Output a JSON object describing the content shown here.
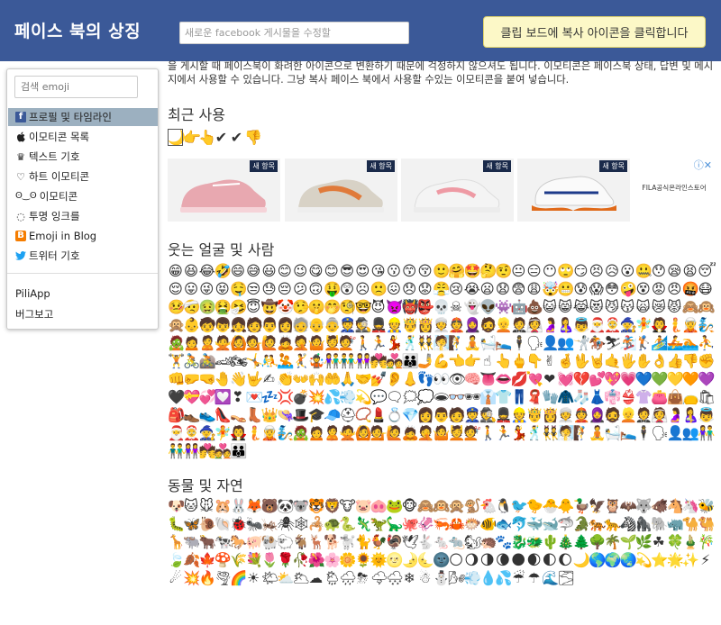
{
  "header": {
    "title": "페이스 북의 상징",
    "post_placeholder": "새로운 facebook 게시물을 수정할",
    "copy_hint": "클립 보드에 복사 아이콘을 클릭합니다"
  },
  "sidebar": {
    "search_placeholder": "검색 emoji",
    "items": [
      {
        "label": "프로필 및 타임라인",
        "icon": "facebook-icon",
        "glyph": "f"
      },
      {
        "label": "이모티콘 목록",
        "icon": "apple-icon",
        "glyph": ""
      },
      {
        "label": "텍스트 기호",
        "icon": "crown-icon",
        "glyph": "♛"
      },
      {
        "label": "하트 이모티콘",
        "icon": "heart-icon",
        "glyph": "♡"
      },
      {
        "label": "이모티콘",
        "icon": "face-text-icon",
        "glyph": "ʘ‿ʘ"
      },
      {
        "label": "투명 잉크를",
        "icon": "dotted-circle-icon",
        "glyph": "◌"
      },
      {
        "label": "Emoji in Blog",
        "icon": "blogger-icon",
        "glyph": "B"
      },
      {
        "label": "트위터 기호",
        "icon": "twitter-icon",
        "glyph": "🐦"
      },
      {
        "label": "PiliApp"
      },
      {
        "label": "버그보고"
      }
    ]
  },
  "intro": "을 게시할 때 페이스북이 화려한 아이콘으로 변환하기 때문에 걱정하지 않으셔도 됩니다. 이모티콘은 페이스북 상태, 답변 및 메시지에서 사용할 수 있습니다. 그냥 복사 페이스 북에서 사용할 수있는 이모티콘을 붙여 넣습니다.",
  "sections": {
    "recent": "최근 사용",
    "smileys": "웃는 얼굴 및 사람",
    "animals": "동물 및 자연"
  },
  "recent_emojis": [
    "🌙",
    "👉",
    "👆",
    "✔",
    "✔",
    "👎"
  ],
  "ad": {
    "badge": "새 항목",
    "brand": "FILA공식온라인스토어",
    "cards": [
      {
        "color": "#e8a8b0"
      },
      {
        "color": "#e07a3a"
      },
      {
        "color": "#ee9aa4"
      },
      {
        "color": "#e06a1a"
      }
    ]
  },
  "smileys_emojis": "😁😆😂🤣😄😅😃😊😉😋😊😎😍😘😗😙😚🙂🤗🤩🤔🤨😐😑😶🙄😏😣😥😮🤐😯😪😫😴😌😛😜😝🤤😒😓😔😕🙃🤑😲☹🙁😖😞😟😤😢😭😦😧😨😩🤯😬😰😱😳🤪😵😡😠🤬😷🤒🤕🤢🤮🤧😇🤠🤡🤥🤫🤭🧐🤓😈👿👹👺💀☠👻👽👾🤖💩😺😸😹😻😼😽🙀😿😾🙈🙉🙊👶🧒👦👧🧑👨👩🧓👴👵👮🕵💂👷🤴👸👳👲🧕🧔👱🤵👰🤰🤱👼🎅🤶🧙🧚🧛🧜🧝🧞🧟🙍🙎🙅🙆💁🙋🙇🤦🤷💆💇🚶🏃💃🕺👯🧖🧗🧘🛀🛌🕴🗣👤👥🤺🏇⛷🏂🏌🏄🚣🏊⛹🏋🚴🚵🏎🏍🤸🤼🤽🤾🤹👫👬👭💏💑👪🤳💪👈👉☝👆🖕👇✌🤞🖖🤘🤙🖐✋👌👍👎✊👊🤛🤜🤚👋🤟✍👏👐🙌🤲🙏🤝💅👂👃👣👀👁🧠👅👄💋💘❤💓💔💕💖💗💙💚💛🧡💜🖤💝💞💟❣💌💤💢💣💥💦💨💫💬🗨🗯💭🕳👓🕶👔👕👖🧣🧤🧥🧦👗👘👙👚👛👜👝🛍🎒👞👟👠👡👢👑👒🎩🎓🧢⛑📿💄💍💎👩👨🧑👮🕵💂👷🤴👸👳👲🧕🧔👱🤵👰🤰🤱👼🎅🤶🧙🧚🧛🧜🧝🧞🧟🙍🙎🙅🙆💁🙋🙇🤦🤷💆💇🚶🏃💃🕺👯🧖🧗🧘🛀🛌🕴🗣👤👥👫👬👭💏💑👪",
  "animals_emojis": "🐶🐱🐭🐹🐰🦊🐻🐼🐨🐯🦁🐮🐷🐽🐸🐵🙈🙉🙊🐒🐔🐧🐦🐤🐣🐥🦆🦅🦉🦇🐺🐗🐴🦄🐝🐛🦋🐌🐚🐞🐜🦗🕷🕸🦂🐢🐍🦎🦖🦕🐙🦑🦐🦀🐡🐠🐟🐬🐳🐋🦈🐊🐅🐆🦓🦍🐘🦏🐪🐫🦒🐃🐂🐄🐎🐖🐏🐑🐐🦌🐕🐩🐈🐓🦃🕊🐇🐁🐀🐿🦔🐾🐉🐲🌵🎄🌲🌳🌴🌱🌿☘🍀🎍🎋🍃🍂🍁🍄🌾💐🌷🌹🥀🌺🌸🌼🌻🌞🌝🌛🌜🌚🌕🌖🌗🌘🌑🌒🌓🌔🌙🌎🌍🌏💫⭐🌟✨⚡☄💥🔥🌪🌈☀🌤⛅🌥☁🌦🌧⛈🌩🌨❄☃⛄🌬💨💧💦☔☂🌊🌫"
}
